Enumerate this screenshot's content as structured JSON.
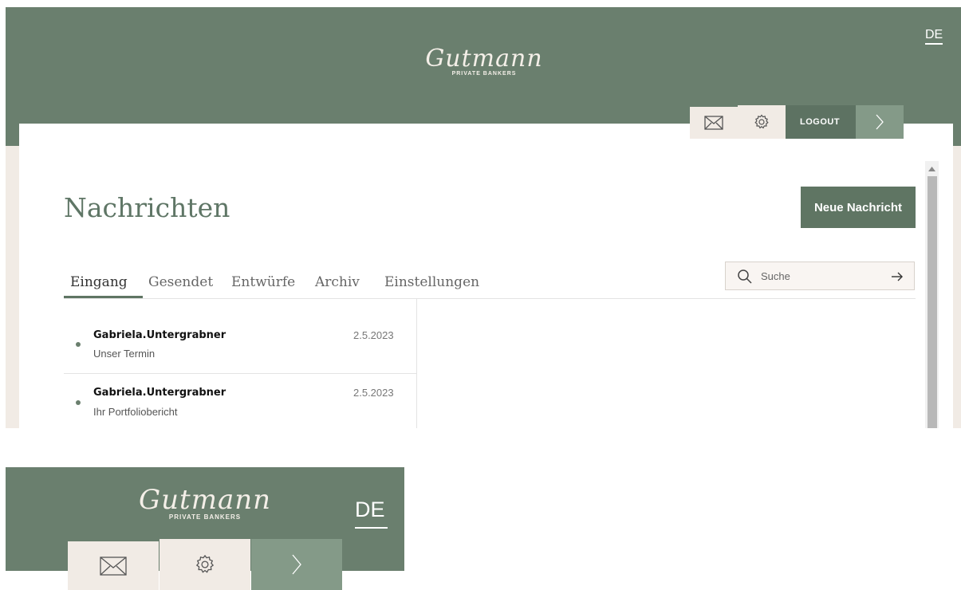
{
  "brand": {
    "logo_script": "Gutmann",
    "logo_sub": "PRIVATE BANKERS"
  },
  "header": {
    "lang": "DE",
    "logout_label": "LOGOUT",
    "icons": [
      "mail-icon",
      "gear-icon",
      "chevron-right-icon"
    ]
  },
  "page": {
    "title": "Nachrichten",
    "new_message_label": "Neue Nachricht"
  },
  "tabs": [
    {
      "label": "Eingang",
      "active": true
    },
    {
      "label": "Gesendet",
      "active": false
    },
    {
      "label": "Entwürfe",
      "active": false
    },
    {
      "label": "Archiv",
      "active": false
    },
    {
      "label": "Einstellungen",
      "active": false
    }
  ],
  "search": {
    "placeholder": "Suche"
  },
  "messages": [
    {
      "sender": "Gabriela.Untergrabner",
      "subject": "Unser Termin",
      "date": "2.5.2023"
    },
    {
      "sender": "Gabriela.Untergrabner",
      "subject": "Ihr Portfoliobericht",
      "date": "2.5.2023"
    }
  ],
  "mobile_header": {
    "lang": "DE"
  },
  "colors": {
    "header_green": "#6a7f6e",
    "button_green": "#5f7563",
    "beige": "#f1ebe5"
  }
}
